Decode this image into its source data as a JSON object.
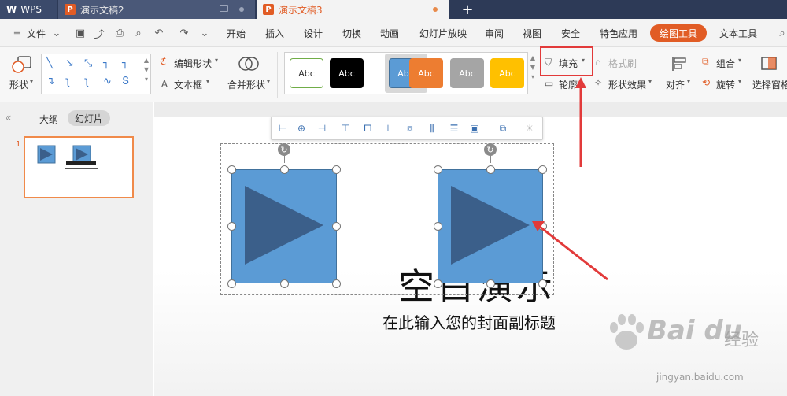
{
  "titlebar": {
    "app_tab": "WPS",
    "doc_tabs": [
      "演示文稿2",
      "演示文稿3"
    ],
    "new_tab": "+"
  },
  "menubar": {
    "file": "文件",
    "items": [
      "开始",
      "插入",
      "设计",
      "切换",
      "动画",
      "幻灯片放映",
      "审阅",
      "视图",
      "安全",
      "特色应用",
      "绘图工具",
      "文本工具"
    ],
    "active": "绘图工具"
  },
  "ribbon": {
    "shape": "形状",
    "edit_shape": "编辑形状",
    "textbox": "文本框",
    "merge_shape": "合并形状",
    "style_swatches": [
      "Abc",
      "Abc",
      "Abc",
      "Abc",
      "Abc",
      "Abc"
    ],
    "fill": "填充",
    "format_brush": "格式刷",
    "outline": "轮廓",
    "shape_effect": "形状效果",
    "align": "对齐",
    "group": "组合",
    "rotate": "旋转",
    "select_pane": "选择窗格"
  },
  "colors": {
    "accent": "#e15c25",
    "shape_fill": "#5b9bd5",
    "triangle": "#3b5f8a",
    "annotation": "#e23a3a",
    "swatches": [
      "#ffffff",
      "#000000",
      "#5b9bd5",
      "#ed7d31",
      "#a5a5a5",
      "#ffc000"
    ]
  },
  "leftpanel": {
    "outline_tab": "大纲",
    "slides_tab": "幻灯片",
    "slide_number": "1"
  },
  "slide": {
    "title": "空白演示",
    "subtitle": "在此输入您的封面副标题"
  },
  "watermark": {
    "brand": "Bai du",
    "cn": "经验",
    "url": "jingyan.baidu.com"
  }
}
